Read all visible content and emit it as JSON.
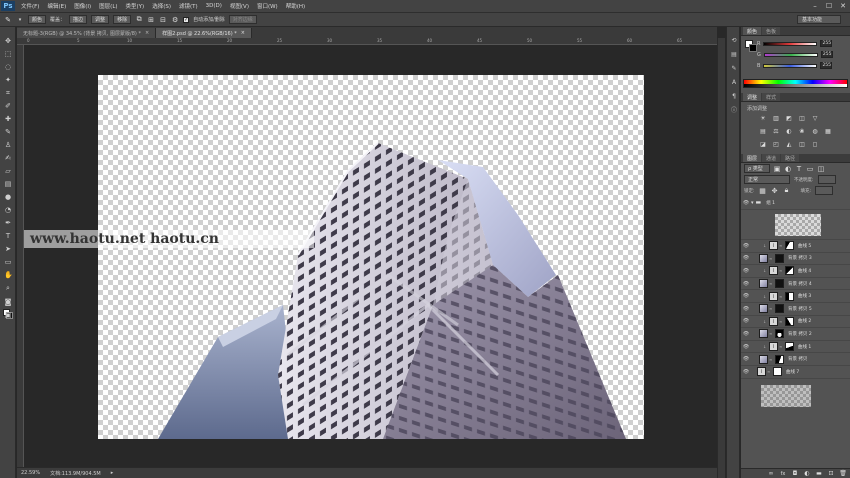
{
  "app": {
    "logo": "Ps"
  },
  "menu": [
    "文件(F)",
    "编辑(E)",
    "图像(I)",
    "图层(L)",
    "类型(Y)",
    "选择(S)",
    "滤镜(T)",
    "3D(D)",
    "视图(V)",
    "窗口(W)",
    "帮助(H)"
  ],
  "window_controls": [
    "–",
    "☐",
    "✕"
  ],
  "options_bar": {
    "preset": "颜色",
    "cover_label": "覆盖：",
    "cover_value": "描边",
    "add_btn": "调整",
    "subtract_btn": "移除",
    "auto_label": "自动添加/删除",
    "align_btn": "对齐边缘"
  },
  "workspace": "基本功能",
  "tabs": [
    {
      "label": "无标题-3(RGB) @ 34.5% (背景 拷贝, 图层蒙版/8) *",
      "active": false
    },
    {
      "label": "样图2.psd @ 22.6%(RGB/16) *",
      "active": true
    }
  ],
  "ruler_ticks": [
    "0",
    "5",
    "10",
    "15",
    "20",
    "25",
    "30",
    "35",
    "40",
    "45",
    "50",
    "55",
    "60",
    "65"
  ],
  "watermark": "www.haotu.net  haotu.cn",
  "status": {
    "zoom": "22.59%",
    "doc": "文档:113.9M/904.5M"
  },
  "colors": {
    "tabs": [
      "颜色",
      "色板"
    ],
    "channels": [
      {
        "label": "R",
        "value": "255",
        "color": "#e23b3b"
      },
      {
        "label": "G",
        "value": "255",
        "color": "#39b14c"
      },
      {
        "label": "B",
        "value": "255",
        "color": "#3b5ee2"
      }
    ]
  },
  "adjustments": {
    "tabs": [
      "调整",
      "样式"
    ],
    "title": "添加调整",
    "icons": [
      "☀",
      "▥",
      "◩",
      "◫",
      "▽",
      "",
      "▤",
      "⚖",
      "◐",
      "❀",
      "◍",
      "▦",
      "◪",
      "◰",
      "◭",
      "◫",
      "◻",
      ""
    ]
  },
  "layers_panel": {
    "tabs": [
      "图层",
      "通道",
      "路径"
    ],
    "filter": "ρ 类型",
    "blend": "正常",
    "opacity_label": "不透明度:",
    "fill_label": "填充:",
    "lock_label": "锁定:",
    "group_name": "组 1",
    "layers": [
      {
        "name": "曲线 5",
        "kind": "curves",
        "clip": true
      },
      {
        "name": "背景 拷贝 3",
        "kind": "image",
        "clip": false
      },
      {
        "name": "曲线 4",
        "kind": "curves",
        "clip": true
      },
      {
        "name": "背景 拷贝 4",
        "kind": "image",
        "clip": false
      },
      {
        "name": "曲线 3",
        "kind": "curves",
        "clip": true
      },
      {
        "name": "背景 拷贝 5",
        "kind": "image",
        "clip": false
      },
      {
        "name": "曲线 2",
        "kind": "curves",
        "clip": true
      },
      {
        "name": "背景 拷贝 2",
        "kind": "image",
        "clip": false
      },
      {
        "name": "曲线 1",
        "kind": "curves",
        "clip": true
      },
      {
        "name": "背景 拷贝",
        "kind": "image",
        "clip": false
      },
      {
        "name": "曲线 7",
        "kind": "curves",
        "clip": false
      }
    ],
    "bottom_icons": [
      "link-icon",
      "fx-icon",
      "mask-icon",
      "adjustment-icon",
      "folder-icon",
      "new-layer-icon",
      "trash-icon"
    ]
  }
}
